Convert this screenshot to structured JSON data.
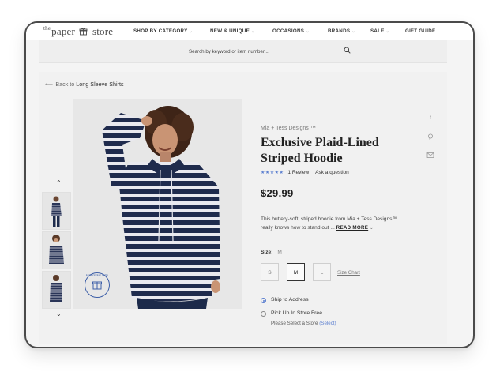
{
  "header": {
    "logo_the": "the",
    "logo_paper": "paper",
    "logo_store": "store",
    "nav": [
      {
        "label": "SHOP BY CATEGORY",
        "chevron": true
      },
      {
        "label": "NEW & UNIQUE",
        "chevron": true
      },
      {
        "label": "OCCASIONS",
        "chevron": true
      },
      {
        "label": "BRANDS",
        "chevron": true
      },
      {
        "label": "SALE",
        "chevron": true
      },
      {
        "label": "GIFT GUIDE",
        "chevron": false
      }
    ]
  },
  "search": {
    "placeholder": "Search by keyword or item number...",
    "icon": "search-icon"
  },
  "breadcrumb": {
    "prefix": "Back to",
    "category": "Long Sleeve Shirts"
  },
  "product": {
    "brand": "Mia + Tess Designs ™",
    "title": "Exclusive Plaid-Lined Striped Hoodie",
    "stars": "★★★★★",
    "rating_value": 5,
    "reviews": "1 Review",
    "ask": "Ask a question",
    "price": "$29.99",
    "description": "This buttery-soft, striped hoodie from Mia + Tess Designs™ really knows how to stand out ...",
    "read_more": "READ MORE",
    "size_label": "Size:",
    "size_selected": "M",
    "sizes": [
      "S",
      "M",
      "L"
    ],
    "size_chart": "Size Chart",
    "badge_text": "EXCLUSIVELY OURS"
  },
  "fulfillment": {
    "ship_label": "Ship to Address",
    "pickup_label": "Pick Up In Store Free",
    "pickup_sub": "Please Select a Store",
    "pickup_link": "(Select)"
  },
  "share": [
    "facebook-icon",
    "pinterest-icon",
    "email-icon"
  ],
  "colors": {
    "accent": "#5b7fd0",
    "stripe_navy": "#1f2b4d",
    "background": "#f1f1f1"
  }
}
